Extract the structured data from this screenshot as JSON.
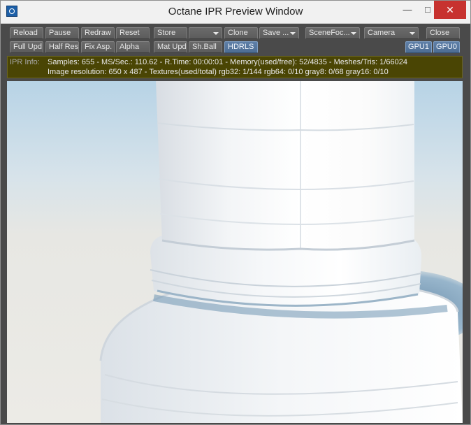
{
  "window": {
    "title": "Octane IPR Preview Window",
    "minimize_glyph": "—",
    "maximize_glyph": "□",
    "close_glyph": "✕"
  },
  "toolbar": {
    "reload": "Reload",
    "pause": "Pause",
    "redraw": "Redraw",
    "reset": "Reset",
    "store": "Store",
    "store_slot": "",
    "clone": "Clone",
    "save": "Save ...",
    "scene_focus": "SceneFoc...",
    "camera": "Camera",
    "close": "Close",
    "full_upd": "Full Upd.",
    "half_res": "Half Res",
    "fix_asp": "Fix Asp.",
    "alpha": "Alpha",
    "mat_upd": "Mat Upd",
    "sh_ball": "Sh.Ball",
    "hdrls": "HDRLS",
    "gpu1": "GPU1",
    "gpu0": "GPU0"
  },
  "info": {
    "label": "IPR Info:",
    "line1": "Samples: 655  -  MS/Sec.: 110.62  -  R.Time: 00:00:01 - Memory(used/free): 52/4835  -  Meshes/Tris: 1/66024",
    "line2": "Image resolution: 650 x 487 - Textures(used/total) rgb32: 1/144   rgb64: 0/10   gray8: 0/68   gray16: 0/10"
  },
  "render_view": {
    "subject": "white stone column base render"
  },
  "colors": {
    "toolbar_bg": "#4a4a4a",
    "button_bg": "#636363",
    "button_active_blue": "#56779e",
    "info_bg": "#4a4504",
    "close_red": "#c7322f"
  }
}
